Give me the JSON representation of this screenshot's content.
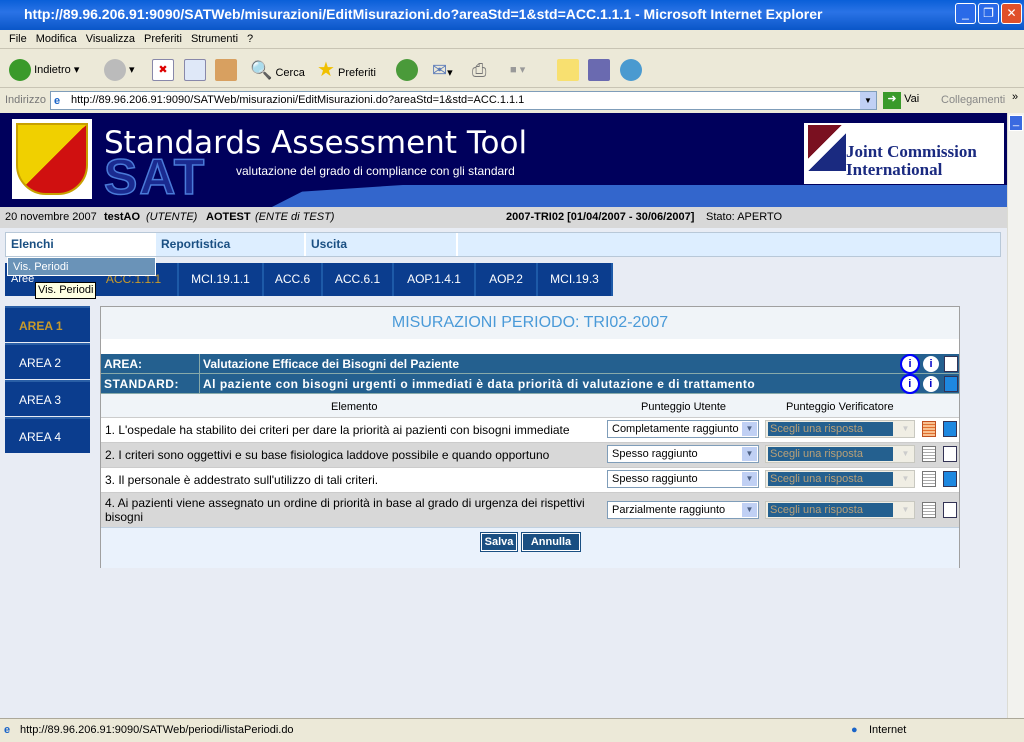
{
  "window": {
    "title": "http://89.96.206.91:9090/SATWeb/misurazioni/EditMisurazioni.do?areaStd=1&std=ACC.1.1.1 - Microsoft Internet Explorer"
  },
  "menu": [
    "File",
    "Modifica",
    "Visualizza",
    "Preferiti",
    "Strumenti",
    "?"
  ],
  "toolbar": {
    "back": "Indietro",
    "search": "Cerca",
    "favorites": "Preferiti"
  },
  "address": {
    "label": "Indirizzo",
    "url": "http://89.96.206.91:9090/SATWeb/misurazioni/EditMisurazioni.do?areaStd=1&std=ACC.1.1.1",
    "go": "Vai",
    "links": "Collegamenti"
  },
  "banner": {
    "title": "Standards Assessment Tool",
    "logo_text": "SAT",
    "subtitle": "valutazione del grado di compliance con gli standard",
    "partner": "Joint Commission International"
  },
  "info": {
    "date": "20 novembre 2007",
    "user": "testAO",
    "user_role": "(UTENTE)",
    "org": "AOTEST",
    "org_desc": "(ENTE di TEST)",
    "period": "2007-TRI02 [01/04/2007 - 30/06/2007]",
    "state": "Stato: APERTO"
  },
  "nav": {
    "items": [
      "Elenchi",
      "Reportistica",
      "Uscita"
    ],
    "dropdown": [
      "Vis. Periodi"
    ],
    "tooltip": "Vis. Periodi"
  },
  "left": {
    "header": "Aree",
    "areas": [
      "AREA 1",
      "AREA 2",
      "AREA 3",
      "AREA 4"
    ]
  },
  "tabs": [
    "ACC.1.1.1",
    "MCI.19.1.1",
    "ACC.6",
    "ACC.6.1",
    "AOP.1.4.1",
    "AOP.2",
    "MCI.19.3"
  ],
  "panel": {
    "title": "MISURAZIONI PERIODO: TRI02-2007",
    "area_label": "AREA:",
    "area_value": "Valutazione Efficace dei Bisogni del Paziente",
    "standard_label": "STANDARD:",
    "standard_value": "Al paziente con bisogni urgenti o immediati è data priorità di valutazione e di trattamento",
    "columns": [
      "Elemento",
      "Punteggio Utente",
      "Punteggio Verificatore"
    ],
    "rows": [
      {
        "text": "1. L'ospedale ha stabilito dei criteri per dare la priorità ai pazienti con bisogni immediate",
        "user": "Completamente raggiunto",
        "verifier": "Scegli una risposta"
      },
      {
        "text": "2. I criteri sono oggettivi e su base fisiologica laddove possibile e quando opportuno",
        "user": "Spesso raggiunto",
        "verifier": "Scegli una risposta"
      },
      {
        "text": "3. Il personale è addestrato sull'utilizzo di tali criteri.",
        "user": "Spesso raggiunto",
        "verifier": "Scegli una risposta"
      },
      {
        "text": "4. Ai pazienti viene assegnato un ordine di priorità in base al grado di urgenza dei rispettivi bisogni",
        "user": "Parzialmente raggiunto",
        "verifier": "Scegli una risposta"
      }
    ],
    "save": "Salva",
    "cancel": "Annulla"
  },
  "status": {
    "url": "http://89.96.206.91:9090/SATWeb/periodi/listaPeriodi.do",
    "zone": "Internet"
  },
  "colors": {
    "navy": "#00005c",
    "tab": "#0b3d8e",
    "bar": "#24608f",
    "active": "#c89a2a",
    "title": "#4a9ad8"
  }
}
